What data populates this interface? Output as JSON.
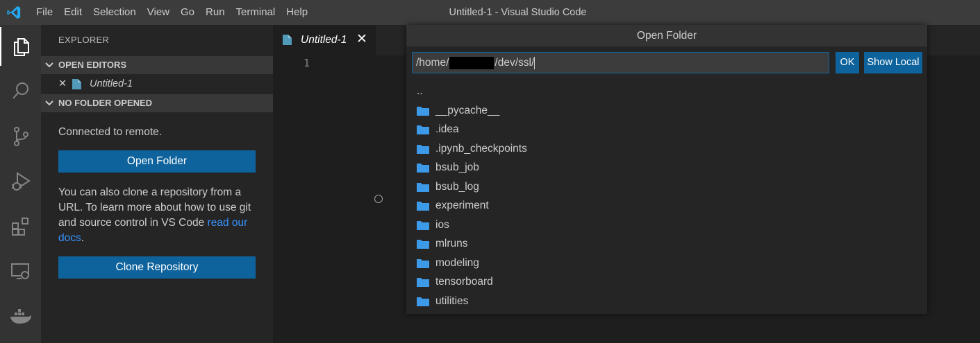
{
  "menu": [
    "File",
    "Edit",
    "Selection",
    "View",
    "Go",
    "Run",
    "Terminal",
    "Help"
  ],
  "window_title": "Untitled-1 - Visual Studio Code",
  "activity_icons": [
    "explorer-icon",
    "search-icon",
    "source-control-icon",
    "run-debug-icon",
    "extensions-icon",
    "remote-explorer-icon",
    "docker-icon"
  ],
  "sidebar": {
    "title": "EXPLORER",
    "open_editors": "OPEN EDITORS",
    "open_file": "Untitled-1",
    "close_glyph": "✕",
    "no_folder": "NO FOLDER OPENED",
    "connected": "Connected to remote.",
    "open_folder_btn": "Open Folder",
    "clone_text": "You can also clone a repository from a URL. To learn more about how to use git and source control in VS Code ",
    "clone_link": "read our docs",
    "clone_end": ".",
    "clone_btn": "Clone Repository"
  },
  "editor": {
    "tab_name": "Untitled-1",
    "tab_close": "✕",
    "line_number": "1"
  },
  "dialog": {
    "title": "Open Folder",
    "path_prefix": "/home/",
    "path_suffix": "/dev/ssl/",
    "ok": "OK",
    "show_local": "Show Local",
    "parent": "..",
    "folders": [
      "__pycache__",
      ".idea",
      ".ipynb_checkpoints",
      "bsub_job",
      "bsub_log",
      "experiment",
      "ios",
      "mlruns",
      "modeling",
      "tensorboard",
      "utilities"
    ]
  },
  "colors": {
    "accent": "#0e639c",
    "folder": "#3c9ae8",
    "link": "#3794ff",
    "file_icon": "#519aba"
  }
}
